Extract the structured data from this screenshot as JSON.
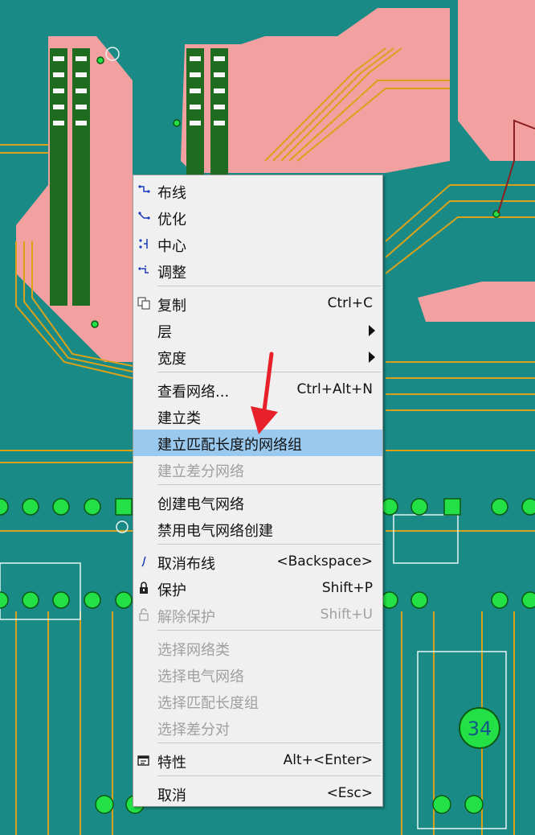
{
  "menu": {
    "items": [
      {
        "label": "布线",
        "shortcut": "",
        "icon": "route-icon"
      },
      {
        "label": "优化",
        "shortcut": "",
        "icon": "optimize-icon"
      },
      {
        "label": "中心",
        "shortcut": "",
        "icon": "center-icon"
      },
      {
        "label": "调整",
        "shortcut": "",
        "icon": "adjust-icon"
      },
      {
        "label": "复制",
        "shortcut": "Ctrl+C",
        "icon": "copy-icon"
      },
      {
        "label": "层",
        "shortcut": "",
        "submenu": true
      },
      {
        "label": "宽度",
        "shortcut": "",
        "submenu": true
      },
      {
        "label": "查看网络...",
        "shortcut": "Ctrl+Alt+N"
      },
      {
        "label": "建立类",
        "shortcut": ""
      },
      {
        "label": "建立匹配长度的网络组",
        "shortcut": "",
        "highlighted": true
      },
      {
        "label": "建立差分网络",
        "shortcut": "",
        "disabled": true
      },
      {
        "label": "创建电气网络",
        "shortcut": ""
      },
      {
        "label": "禁用电气网络创建",
        "shortcut": ""
      },
      {
        "label": "取消布线",
        "shortcut": "<Backspace>",
        "icon": "unroute-icon"
      },
      {
        "label": "保护",
        "shortcut": "Shift+P",
        "icon": "lock-icon"
      },
      {
        "label": "解除保护",
        "shortcut": "Shift+U",
        "icon": "unlock-icon",
        "disabled": true
      },
      {
        "label": "选择网络类",
        "shortcut": "",
        "disabled": true
      },
      {
        "label": "选择电气网络",
        "shortcut": "",
        "disabled": true
      },
      {
        "label": "选择匹配长度组",
        "shortcut": "",
        "disabled": true
      },
      {
        "label": "选择差分对",
        "shortcut": "",
        "disabled": true
      },
      {
        "label": "特性",
        "shortcut": "Alt+<Enter>",
        "icon": "properties-icon"
      },
      {
        "label": "取消",
        "shortcut": "<Esc>"
      }
    ]
  },
  "board": {
    "pad_label": "34"
  },
  "colors": {
    "board_bg": "#1a8a86",
    "copper": "#f2a0a0",
    "trace": "#d9a21a",
    "pad": "#22e046",
    "highlight": "#99c9ef",
    "arrow": "#e8202a"
  }
}
